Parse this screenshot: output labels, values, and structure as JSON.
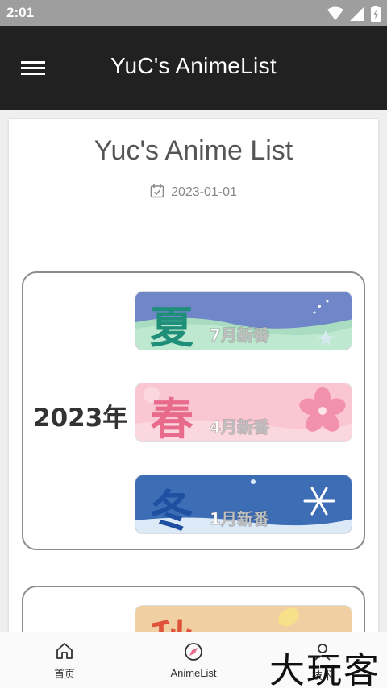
{
  "status": {
    "time": "2:01"
  },
  "appbar": {
    "title": "YuC's AnimeList"
  },
  "post": {
    "title": "Yuc's Anime List",
    "date": "2023-01-01"
  },
  "years": [
    {
      "label": "2023年",
      "seasons": [
        {
          "glyph": "夏",
          "sub": "7月新番",
          "glyph_color": "#1f8f7a"
        },
        {
          "glyph": "春",
          "sub": "4月新番",
          "glyph_color": "#e86b8c"
        },
        {
          "glyph": "冬",
          "sub": "1月新番",
          "glyph_color": "#1e4fa0"
        }
      ]
    },
    {
      "seasons": [
        {
          "glyph": "秋",
          "glyph_color": "#e0533a"
        }
      ]
    }
  ],
  "nav": {
    "items": [
      {
        "label": "首页"
      },
      {
        "label": "AnimeList"
      },
      {
        "label": "技术"
      }
    ]
  },
  "watermark": "大玩客",
  "colors": {
    "appbar": "#212121",
    "status_bar": "#9e9e9e"
  }
}
